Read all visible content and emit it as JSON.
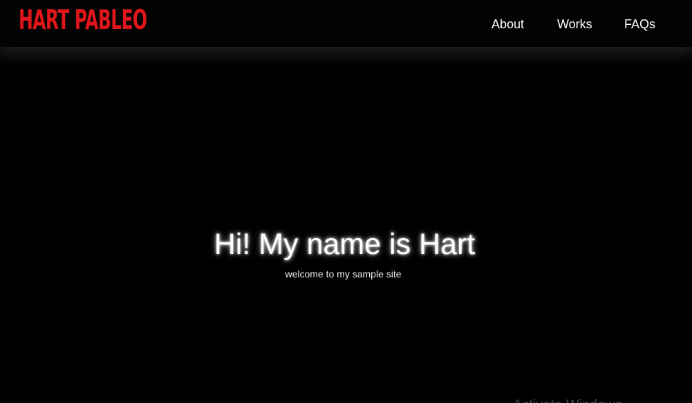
{
  "header": {
    "logo_text": "HART PABLEO",
    "nav": [
      {
        "label": "About"
      },
      {
        "label": "Works"
      },
      {
        "label": "FAQs"
      }
    ]
  },
  "hero": {
    "title": "Hi! My name is Hart",
    "subtitle": "welcome to my sample site"
  },
  "overlay": {
    "watermark_text": "Activate Windows"
  },
  "colors": {
    "background": "#000000",
    "logo": "#e0161b",
    "text": "#ffffff"
  }
}
